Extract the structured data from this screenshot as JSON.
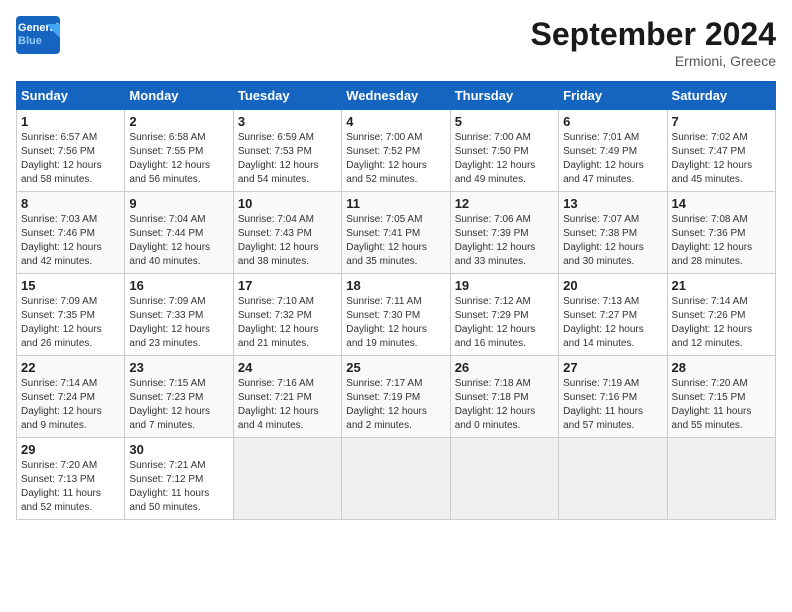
{
  "header": {
    "logo_general": "General",
    "logo_blue": "Blue",
    "month_title": "September 2024",
    "location": "Ermioni, Greece"
  },
  "weekdays": [
    "Sunday",
    "Monday",
    "Tuesday",
    "Wednesday",
    "Thursday",
    "Friday",
    "Saturday"
  ],
  "weeks": [
    [
      {
        "day": "1",
        "info": "Sunrise: 6:57 AM\nSunset: 7:56 PM\nDaylight: 12 hours\nand 58 minutes."
      },
      {
        "day": "2",
        "info": "Sunrise: 6:58 AM\nSunset: 7:55 PM\nDaylight: 12 hours\nand 56 minutes."
      },
      {
        "day": "3",
        "info": "Sunrise: 6:59 AM\nSunset: 7:53 PM\nDaylight: 12 hours\nand 54 minutes."
      },
      {
        "day": "4",
        "info": "Sunrise: 7:00 AM\nSunset: 7:52 PM\nDaylight: 12 hours\nand 52 minutes."
      },
      {
        "day": "5",
        "info": "Sunrise: 7:00 AM\nSunset: 7:50 PM\nDaylight: 12 hours\nand 49 minutes."
      },
      {
        "day": "6",
        "info": "Sunrise: 7:01 AM\nSunset: 7:49 PM\nDaylight: 12 hours\nand 47 minutes."
      },
      {
        "day": "7",
        "info": "Sunrise: 7:02 AM\nSunset: 7:47 PM\nDaylight: 12 hours\nand 45 minutes."
      }
    ],
    [
      {
        "day": "8",
        "info": "Sunrise: 7:03 AM\nSunset: 7:46 PM\nDaylight: 12 hours\nand 42 minutes."
      },
      {
        "day": "9",
        "info": "Sunrise: 7:04 AM\nSunset: 7:44 PM\nDaylight: 12 hours\nand 40 minutes."
      },
      {
        "day": "10",
        "info": "Sunrise: 7:04 AM\nSunset: 7:43 PM\nDaylight: 12 hours\nand 38 minutes."
      },
      {
        "day": "11",
        "info": "Sunrise: 7:05 AM\nSunset: 7:41 PM\nDaylight: 12 hours\nand 35 minutes."
      },
      {
        "day": "12",
        "info": "Sunrise: 7:06 AM\nSunset: 7:39 PM\nDaylight: 12 hours\nand 33 minutes."
      },
      {
        "day": "13",
        "info": "Sunrise: 7:07 AM\nSunset: 7:38 PM\nDaylight: 12 hours\nand 30 minutes."
      },
      {
        "day": "14",
        "info": "Sunrise: 7:08 AM\nSunset: 7:36 PM\nDaylight: 12 hours\nand 28 minutes."
      }
    ],
    [
      {
        "day": "15",
        "info": "Sunrise: 7:09 AM\nSunset: 7:35 PM\nDaylight: 12 hours\nand 26 minutes."
      },
      {
        "day": "16",
        "info": "Sunrise: 7:09 AM\nSunset: 7:33 PM\nDaylight: 12 hours\nand 23 minutes."
      },
      {
        "day": "17",
        "info": "Sunrise: 7:10 AM\nSunset: 7:32 PM\nDaylight: 12 hours\nand 21 minutes."
      },
      {
        "day": "18",
        "info": "Sunrise: 7:11 AM\nSunset: 7:30 PM\nDaylight: 12 hours\nand 19 minutes."
      },
      {
        "day": "19",
        "info": "Sunrise: 7:12 AM\nSunset: 7:29 PM\nDaylight: 12 hours\nand 16 minutes."
      },
      {
        "day": "20",
        "info": "Sunrise: 7:13 AM\nSunset: 7:27 PM\nDaylight: 12 hours\nand 14 minutes."
      },
      {
        "day": "21",
        "info": "Sunrise: 7:14 AM\nSunset: 7:26 PM\nDaylight: 12 hours\nand 12 minutes."
      }
    ],
    [
      {
        "day": "22",
        "info": "Sunrise: 7:14 AM\nSunset: 7:24 PM\nDaylight: 12 hours\nand 9 minutes."
      },
      {
        "day": "23",
        "info": "Sunrise: 7:15 AM\nSunset: 7:23 PM\nDaylight: 12 hours\nand 7 minutes."
      },
      {
        "day": "24",
        "info": "Sunrise: 7:16 AM\nSunset: 7:21 PM\nDaylight: 12 hours\nand 4 minutes."
      },
      {
        "day": "25",
        "info": "Sunrise: 7:17 AM\nSunset: 7:19 PM\nDaylight: 12 hours\nand 2 minutes."
      },
      {
        "day": "26",
        "info": "Sunrise: 7:18 AM\nSunset: 7:18 PM\nDaylight: 12 hours\nand 0 minutes."
      },
      {
        "day": "27",
        "info": "Sunrise: 7:19 AM\nSunset: 7:16 PM\nDaylight: 11 hours\nand 57 minutes."
      },
      {
        "day": "28",
        "info": "Sunrise: 7:20 AM\nSunset: 7:15 PM\nDaylight: 11 hours\nand 55 minutes."
      }
    ],
    [
      {
        "day": "29",
        "info": "Sunrise: 7:20 AM\nSunset: 7:13 PM\nDaylight: 11 hours\nand 52 minutes."
      },
      {
        "day": "30",
        "info": "Sunrise: 7:21 AM\nSunset: 7:12 PM\nDaylight: 11 hours\nand 50 minutes."
      },
      null,
      null,
      null,
      null,
      null
    ]
  ]
}
